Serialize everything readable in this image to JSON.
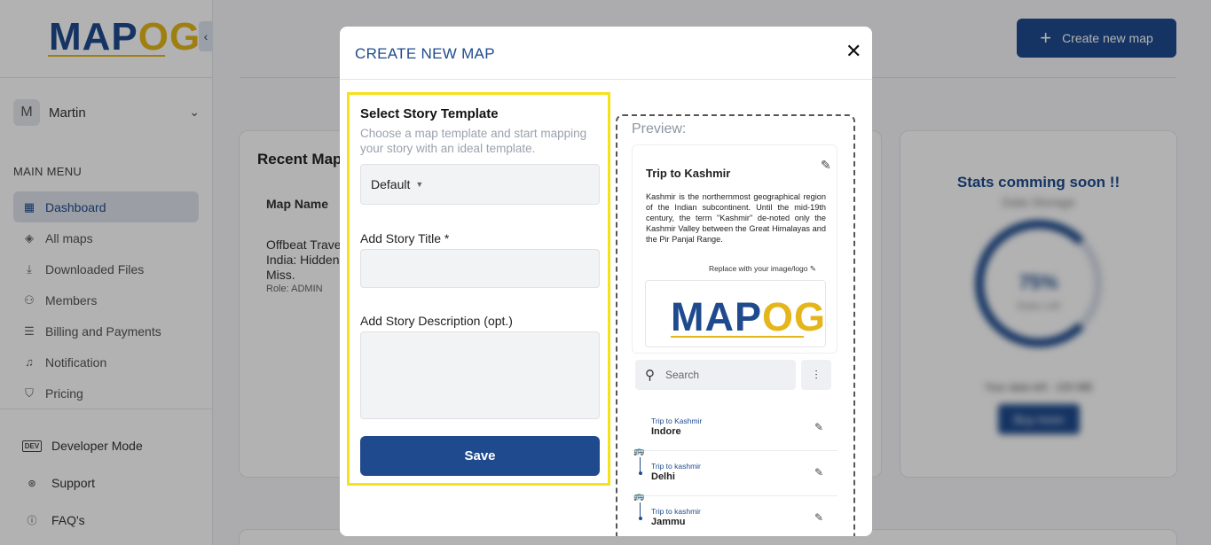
{
  "sidebar": {
    "logo": {
      "part1": "MAP",
      "part2": "OG"
    },
    "user": {
      "initial": "M",
      "name": "Martin"
    },
    "main_menu_label": "MAIN MENU",
    "items": [
      {
        "label": "Dashboard",
        "icon": "grid-icon",
        "active": true
      },
      {
        "label": "All maps",
        "icon": "layers-icon"
      },
      {
        "label": "Downloaded Files",
        "icon": "download-icon"
      },
      {
        "label": "Members",
        "icon": "user-icon"
      },
      {
        "label": "Billing and Payments",
        "icon": "billing-icon"
      },
      {
        "label": "Notification",
        "icon": "bell-icon"
      },
      {
        "label": "Pricing",
        "icon": "tag-icon"
      }
    ],
    "bottom_items": [
      {
        "label": "Developer Mode",
        "icon": "dev-icon",
        "badge": "DEV"
      },
      {
        "label": "Support",
        "icon": "support-icon"
      },
      {
        "label": "FAQ's",
        "icon": "question-icon"
      }
    ]
  },
  "header": {
    "create_button": "Create new map"
  },
  "recent_maps": {
    "title": "Recent Map",
    "column": "Map Name",
    "row": {
      "title": "Offbeat Trave India: Hidden Miss.",
      "role": "Role: ADMIN"
    }
  },
  "stats": {
    "title": "Stats comming soon !!",
    "subtitle": "Data Storage",
    "percent": "75%",
    "percent_label": "Data Left",
    "line": "Your data left : 100 MB",
    "buy_button": "Buy more"
  },
  "modal": {
    "title": "CREATE NEW MAP",
    "close": "✕",
    "form": {
      "heading": "Select Story Template",
      "help": "Choose a map template and start mapping your story with an ideal template.",
      "template_value": "Default",
      "title_label": "Add Story Title *",
      "title_value": "",
      "description_label": "Add Story Description (opt.)",
      "description_value": "",
      "save": "Save"
    },
    "preview": {
      "label": "Preview:",
      "card_title": "Trip to Kashmir",
      "card_desc": "Kashmir is the northernmost geographical region of the Indian subcontinent. Until the mid-19th century, the term \"Kashmir\" de-noted only the Kashmir Valley between the Great Himalayas and the Pir Panjal Range.",
      "replace_text": "Replace with your image/logo",
      "logo": {
        "part1": "MAP",
        "part2": "OG"
      },
      "search_placeholder": "Search",
      "items": [
        {
          "small": "Trip to Kashmir",
          "name": "Indore"
        },
        {
          "small": "Trip to kashmir",
          "name": "Delhi"
        },
        {
          "small": "Trip to kashmir",
          "name": "Jammu"
        }
      ]
    }
  },
  "colors": {
    "brand_blue": "#1f4b8e",
    "brand_gold": "#e4b61b",
    "highlight": "#f5e21b"
  }
}
